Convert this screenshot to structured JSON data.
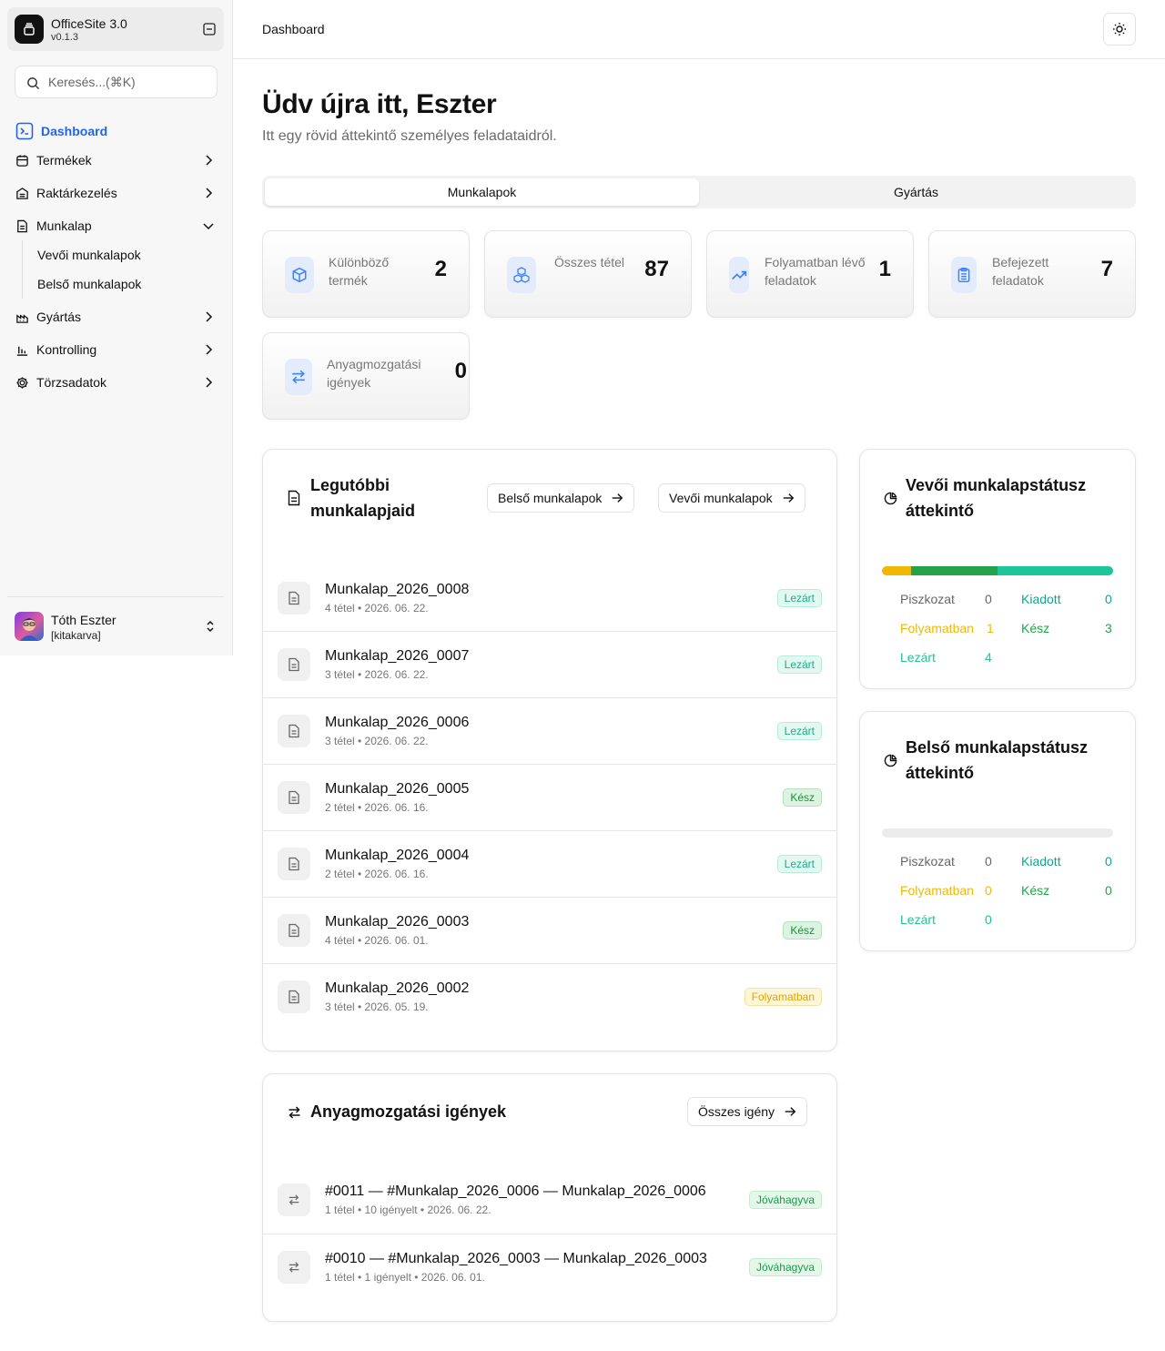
{
  "colors": {
    "accent": "#2563eb",
    "piszkozat": "#666666",
    "folyamatban": "#f2b705",
    "kesz": "#22a34a",
    "lezart": "#1cc59a",
    "kiadott": "#14a38f"
  },
  "app": {
    "name": "OfficeSite 3.0",
    "version": "v0.1.3"
  },
  "search": {
    "placeholder": "Keresés...(⌘K)"
  },
  "nav": {
    "dashboard": "Dashboard",
    "termekek": "Termékek",
    "raktar": "Raktárkezelés",
    "munkalap": "Munkalap",
    "sub": [
      "Vevői munkalapok",
      "Belső munkalapok"
    ],
    "gyartas": "Gyártás",
    "kontrolling": "Kontrolling",
    "torzs": "Törzsadatok"
  },
  "user": {
    "name": "Tóth Eszter",
    "role": "[kitakarva]"
  },
  "header": {
    "breadcrumb": "Dashboard"
  },
  "welcome": {
    "title": "Üdv újra itt, Eszter",
    "subtitle": "Itt egy rövid áttekintő személyes feladataidról."
  },
  "tabs": [
    "Munkalapok",
    "Gyártás"
  ],
  "stats": [
    {
      "label": "Különböző termék",
      "value": "2",
      "icon": "box-icon"
    },
    {
      "label": "Összes tétel",
      "value": "87",
      "icon": "boxes-icon"
    },
    {
      "label": "Folyamatban lévő feladatok",
      "value": "1",
      "icon": "trending-up-icon"
    },
    {
      "label": "Befejezett feladatok",
      "value": "7",
      "icon": "clipboard-list-icon"
    },
    {
      "label": "Anyagmozgatási igények",
      "value": "0",
      "icon": "arrows-exchange-icon"
    }
  ],
  "recent": {
    "title": "Legutóbbi munkalapjaid",
    "btn_internal": "Belső munkalapok",
    "btn_customer": "Vevői munkalapok",
    "rows": [
      {
        "title": "Munkalap_2026_0008",
        "sub": "4 tétel • 2026. 06. 22.",
        "status": "Lezárt"
      },
      {
        "title": "Munkalap_2026_0007",
        "sub": "3 tétel • 2026. 06. 22.",
        "status": "Lezárt"
      },
      {
        "title": "Munkalap_2026_0006",
        "sub": "3 tétel • 2026. 06. 22.",
        "status": "Lezárt"
      },
      {
        "title": "Munkalap_2026_0005",
        "sub": "2 tétel • 2026. 06. 16.",
        "status": "Kész"
      },
      {
        "title": "Munkalap_2026_0004",
        "sub": "2 tétel • 2026. 06. 16.",
        "status": "Lezárt"
      },
      {
        "title": "Munkalap_2026_0003",
        "sub": "4 tétel • 2026. 06. 01.",
        "status": "Kész"
      },
      {
        "title": "Munkalap_2026_0002",
        "sub": "3 tétel • 2026. 05. 19.",
        "status": "Folyamatban"
      }
    ]
  },
  "material": {
    "title": "Anyagmozgatási igények",
    "btn_all": "Összes igény",
    "rows": [
      {
        "title": "#0011 — #Munkalap_2026_0006 — Munkalap_2026_0006",
        "sub": "1 tétel • 10 igényelt • 2026. 06. 22.",
        "status": "Jóváhagyva"
      },
      {
        "title": "#0010 — #Munkalap_2026_0003 — Munkalap_2026_0003",
        "sub": "1 tétel • 1 igényelt • 2026. 06. 01.",
        "status": "Jóváhagyva"
      }
    ]
  },
  "status_customer": {
    "title": "Vevői munkalapstátusz áttekintő",
    "counts": {
      "piszkozat": 0,
      "kiadott": 0,
      "folyamatban": 1,
      "kesz": 3,
      "lezart": 4
    },
    "labels": {
      "piszkozat": "Piszkozat",
      "kiadott": "Kiadott",
      "folyamatban": "Folyamatban",
      "kesz": "Kész",
      "lezart": "Lezárt"
    }
  },
  "status_internal": {
    "title": "Belső munkalapstátusz áttekintő",
    "counts": {
      "piszkozat": 0,
      "kiadott": 0,
      "folyamatban": 0,
      "kesz": 0,
      "lezart": 0
    },
    "labels": {
      "piszkozat": "Piszkozat",
      "kiadott": "Kiadott",
      "folyamatban": "Folyamatban",
      "kesz": "Kész",
      "lezart": "Lezárt"
    }
  }
}
